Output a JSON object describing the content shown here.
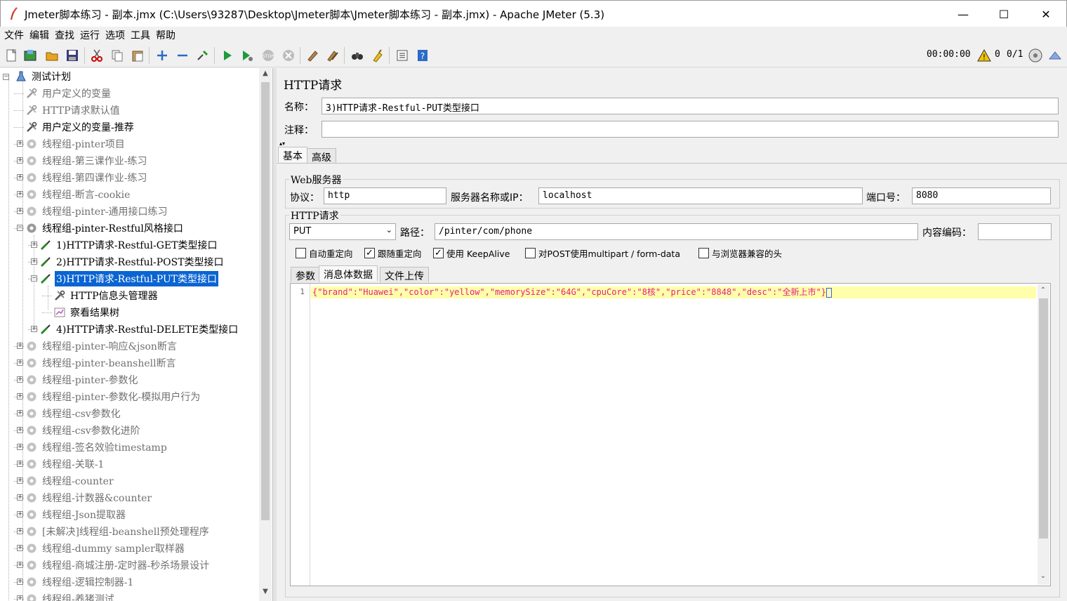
{
  "window": {
    "title": "Jmeter脚本练习 - 副本.jmx (C:\\Users\\93287\\Desktop\\Jmeter脚本\\Jmeter脚本练习 - 副本.jmx) - Apache JMeter (5.3)",
    "minimize_glyph": "—",
    "maximize_glyph": "☐",
    "close_glyph": "✕"
  },
  "menu": [
    "文件",
    "编辑",
    "查找",
    "运行",
    "选项",
    "工具",
    "帮助"
  ],
  "toolbar": {
    "timer": "00:00:00",
    "warning_count": "0",
    "threads": "0/1"
  },
  "tree": {
    "root": "测试计划",
    "items": [
      {
        "label": "用户定义的变量",
        "disabled": true,
        "icon": "wrench-icon"
      },
      {
        "label": "HTTP请求默认值",
        "disabled": true,
        "icon": "wrench-icon"
      },
      {
        "label": "用户定义的变量-推荐",
        "disabled": false,
        "icon": "wrench-icon"
      },
      {
        "label": "线程组-pinter项目",
        "disabled": true,
        "icon": "gear-icon"
      },
      {
        "label": "线程组-第三课作业-练习",
        "disabled": true,
        "icon": "gear-icon"
      },
      {
        "label": "线程组-第四课作业-练习",
        "disabled": true,
        "icon": "gear-icon"
      },
      {
        "label": "线程组-断言-cookie",
        "disabled": true,
        "icon": "gear-icon"
      },
      {
        "label": "线程组-pinter-通用接口练习",
        "disabled": true,
        "icon": "gear-icon"
      },
      {
        "label": "线程组-pinter-Restful风格接口",
        "disabled": false,
        "icon": "gear-icon"
      },
      {
        "label": "1)HTTP请求-Restful-GET类型接口",
        "disabled": false,
        "icon": "pipette-icon"
      },
      {
        "label": "2)HTTP请求-Restful-POST类型接口",
        "disabled": false,
        "icon": "pipette-icon"
      },
      {
        "label": "3)HTTP请求-Restful-PUT类型接口",
        "disabled": false,
        "icon": "pipette-icon"
      },
      {
        "label": "HTTP信息头管理器",
        "disabled": false,
        "icon": "wrench-icon"
      },
      {
        "label": "察看结果树",
        "disabled": false,
        "icon": "chart-icon"
      },
      {
        "label": "4)HTTP请求-Restful-DELETE类型接口",
        "disabled": false,
        "icon": "pipette-icon"
      },
      {
        "label": "线程组-pinter-响应&json断言",
        "disabled": true,
        "icon": "gear-icon"
      },
      {
        "label": "线程组-pinter-beanshell断言",
        "disabled": true,
        "icon": "gear-icon"
      },
      {
        "label": "线程组-pinter-参数化",
        "disabled": true,
        "icon": "gear-icon"
      },
      {
        "label": "线程组-pinter-参数化-模拟用户行为",
        "disabled": true,
        "icon": "gear-icon"
      },
      {
        "label": "线程组-csv参数化",
        "disabled": true,
        "icon": "gear-icon"
      },
      {
        "label": "线程组-csv参数化进阶",
        "disabled": true,
        "icon": "gear-icon"
      },
      {
        "label": "线程组-签名效验timestamp",
        "disabled": true,
        "icon": "gear-icon"
      },
      {
        "label": "线程组-关联-1",
        "disabled": true,
        "icon": "gear-icon"
      },
      {
        "label": "线程组-counter",
        "disabled": true,
        "icon": "gear-icon"
      },
      {
        "label": "线程组-计数器&counter",
        "disabled": true,
        "icon": "gear-icon"
      },
      {
        "label": "线程组-Json提取器",
        "disabled": true,
        "icon": "gear-icon"
      },
      {
        "label": "[未解决]线程组-beanshell预处理程序",
        "disabled": true,
        "icon": "gear-icon"
      },
      {
        "label": "线程组-dummy sampler取样器",
        "disabled": true,
        "icon": "gear-icon"
      },
      {
        "label": "线程组-商城注册-定时器-秒杀场景设计",
        "disabled": true,
        "icon": "gear-icon"
      },
      {
        "label": "线程组-逻辑控制器-1",
        "disabled": true,
        "icon": "gear-icon"
      },
      {
        "label": "线程组-养猪测试",
        "disabled": true,
        "icon": "gear-icon"
      }
    ]
  },
  "http_request": {
    "panel_title": "HTTP请求",
    "name_label": "名称：",
    "name_value": "3)HTTP请求-Restful-PUT类型接口",
    "comment_label": "注释：",
    "comment_value": "",
    "tabs": [
      "基本",
      "高级"
    ],
    "web_server_title": "Web服务器",
    "protocol_label": "协议：",
    "protocol_value": "http",
    "server_label": "服务器名称或IP：",
    "server_value": "localhost",
    "port_label": "端口号：",
    "port_value": "8080",
    "http_section_title": "HTTP请求",
    "method_value": "PUT",
    "path_label": "路径：",
    "path_value": "/pinter/com/phone",
    "encoding_label": "内容编码：",
    "encoding_value": "",
    "checkboxes": [
      {
        "label": "自动重定向",
        "checked": false
      },
      {
        "label": "跟随重定向",
        "checked": true
      },
      {
        "label": "使用 KeepAlive",
        "checked": true
      },
      {
        "label": "对POST使用multipart / form-data",
        "checked": false
      },
      {
        "label": "与浏览器兼容的头",
        "checked": false
      }
    ],
    "sub_tabs": [
      "参数",
      "消息体数据",
      "文件上传"
    ],
    "body_line_number": "1",
    "body_text": "{\"brand\":\"Huawei\",\"color\":\"yellow\",\"memorySize\":\"64G\",\"cpuCore\":\"8核\",\"price\":\"8848\",\"desc\":\"全新上市\"}"
  }
}
